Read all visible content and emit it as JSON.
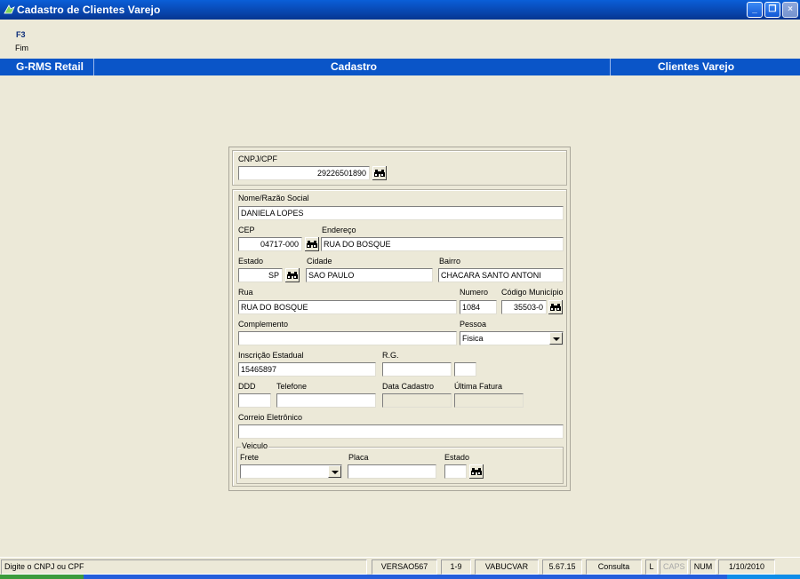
{
  "window": {
    "title": "Cadastro de Clientes Varejo",
    "minimize_glyph": "_",
    "maximize_glyph": "❐",
    "close_glyph": "×"
  },
  "toolbar": {
    "key": "F3",
    "action": "Fim"
  },
  "header": {
    "left": "G-RMS Retail",
    "center": "Cadastro",
    "right": "Clientes Varejo"
  },
  "form": {
    "cnpj_label": "CNPJ/CPF",
    "cnpj_value": "29226501890",
    "nome_label": "Nome/Razão Social",
    "nome_value": "DANIELA LOPES",
    "cep_label": "CEP",
    "cep_value": "04717-000",
    "endereco_label": "Endereço",
    "endereco_value": "RUA DO BOSQUE",
    "estado_label": "Estado",
    "estado_value": "SP",
    "cidade_label": "Cidade",
    "cidade_value": "SAO PAULO",
    "bairro_label": "Bairro",
    "bairro_value": "CHACARA SANTO ANTONI",
    "rua_label": "Rua",
    "rua_value": "RUA DO BOSQUE",
    "numero_label": "Numero",
    "numero_value": "1084",
    "codmun_label": "Código Município",
    "codmun_value": "35503-0",
    "complemento_label": "Complemento",
    "complemento_value": "",
    "pessoa_label": "Pessoa",
    "pessoa_value": "Fisica",
    "ie_label": "Inscrição Estadual",
    "ie_value": "15465897",
    "rg_label": "R.G.",
    "rg_value": "",
    "rg_uf_value": "",
    "ddd_label": "DDD",
    "ddd_value": "",
    "telefone_label": "Telefone",
    "telefone_value": "",
    "data_cadastro_label": "Data Cadastro",
    "data_cadastro_value": "",
    "ultima_fatura_label": "Última Fatura",
    "ultima_fatura_value": "",
    "email_label": "Correio Eletrônico",
    "email_value": "",
    "veiculo_legend": "Veiculo",
    "frete_label": "Frete",
    "frete_value": "",
    "placa_label": "Placa",
    "placa_value": "",
    "veic_estado_label": "Estado",
    "veic_estado_value": ""
  },
  "status": {
    "message": "Digite o CNPJ ou CPF",
    "version": "VERSAO567",
    "range": "1-9",
    "program": "VABUCVAR",
    "build": "5.67.15",
    "mode": "Consulta",
    "l": "L",
    "caps": "CAPS",
    "num": "NUM",
    "date": "1/10/2010"
  },
  "colors": {
    "title_bar": "#0842A8",
    "header_bar": "#0A55C8",
    "window_bg": "#ECE9D8"
  },
  "icons": {
    "search": "binoculars-icon",
    "app": "app-icon"
  }
}
